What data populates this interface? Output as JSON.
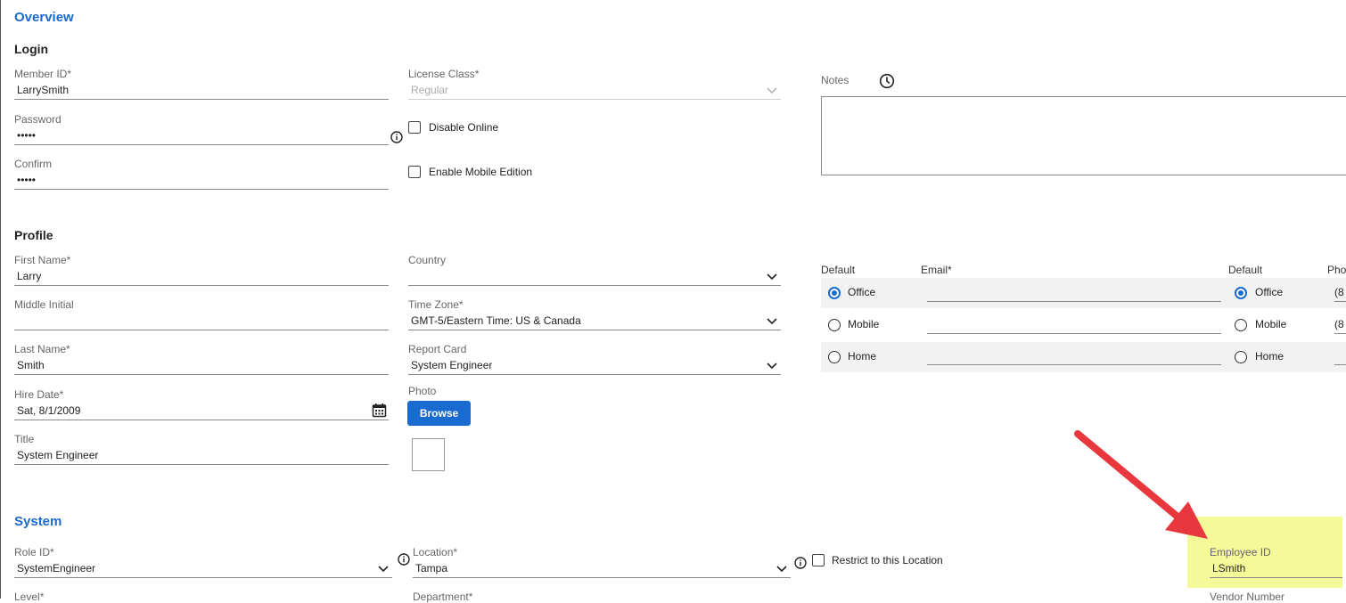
{
  "sections": {
    "overview": "Overview",
    "system": "System"
  },
  "login": {
    "title": "Login",
    "member_id": {
      "label": "Member ID*",
      "value": "LarrySmith"
    },
    "password": {
      "label": "Password",
      "value": "•••••"
    },
    "confirm": {
      "label": "Confirm",
      "value": "•••••"
    },
    "license_class": {
      "label": "License Class*",
      "value": "Regular"
    },
    "disable_online": "Disable Online",
    "enable_mobile": "Enable Mobile Edition",
    "notes_label": "Notes"
  },
  "profile": {
    "title": "Profile",
    "first_name": {
      "label": "First Name*",
      "value": "Larry"
    },
    "middle_initial": {
      "label": "Middle Initial",
      "value": ""
    },
    "last_name": {
      "label": "Last Name*",
      "value": "Smith"
    },
    "hire_date": {
      "label": "Hire Date*",
      "value": "Sat, 8/1/2009"
    },
    "title_field": {
      "label": "Title",
      "value": "System Engineer"
    },
    "country": {
      "label": "Country",
      "value": ""
    },
    "time_zone": {
      "label": "Time Zone*",
      "value": "GMT-5/Eastern Time: US & Canada"
    },
    "report_card": {
      "label": "Report Card",
      "value": "System Engineer"
    },
    "photo": {
      "label": "Photo",
      "button": "Browse"
    }
  },
  "contacts": {
    "email_default_header": "Default",
    "email_header": "Email*",
    "phone_default_header": "Default",
    "phone_header": "Pho",
    "rows": [
      {
        "label": "Office",
        "phone_label": "Office",
        "phone_value": "(8"
      },
      {
        "label": "Mobile",
        "phone_label": "Mobile",
        "phone_value": "(8"
      },
      {
        "label": "Home",
        "phone_label": "Home",
        "phone_value": ""
      }
    ]
  },
  "system": {
    "role_id": {
      "label": "Role ID*",
      "value": "SystemEngineer"
    },
    "location": {
      "label": "Location*",
      "value": "Tampa"
    },
    "restrict": "Restrict to this Location",
    "employee_id": {
      "label": "Employee ID",
      "value": "LSmith"
    },
    "level_label": "Level*",
    "department_label": "Department*",
    "vendor_label": "Vendor Number"
  },
  "colors": {
    "accent": "#1a6bd1",
    "section_title": "#1b6ac9",
    "highlight": "#f4f99a",
    "arrow": "#e8383d"
  }
}
